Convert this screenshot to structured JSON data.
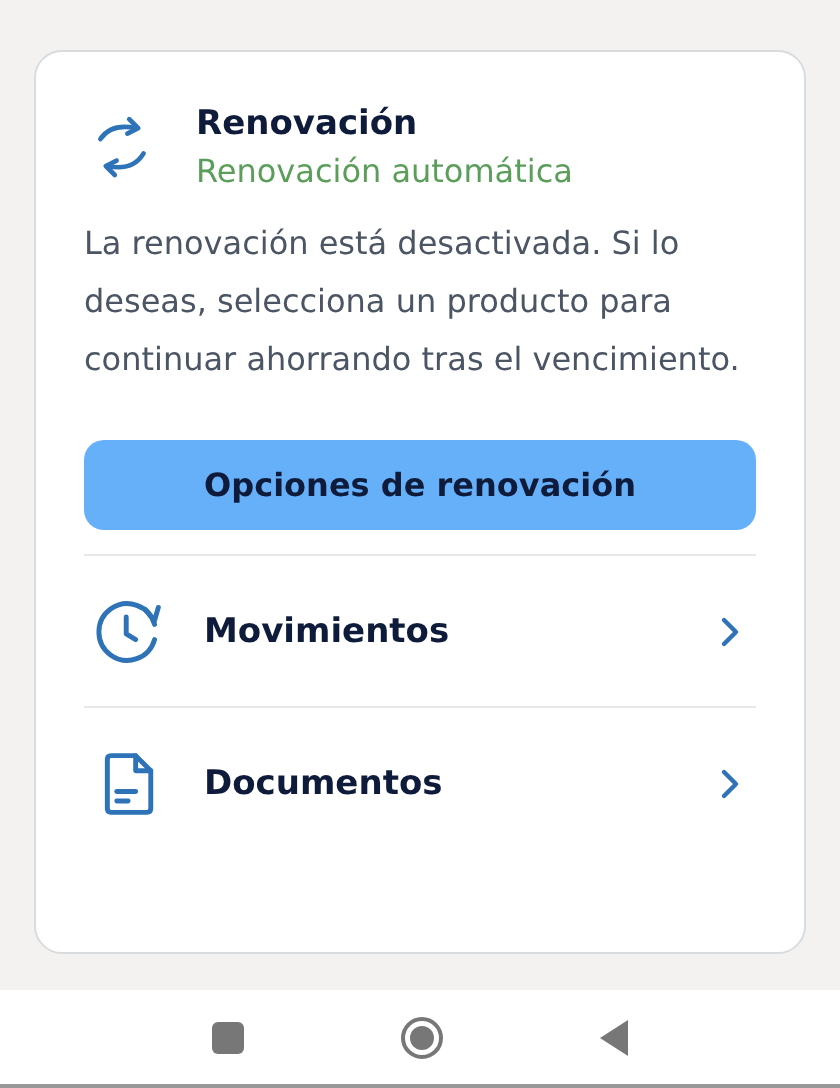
{
  "renewal": {
    "title": "Renovación",
    "subtitle": "Renovación automática",
    "description": "La renovación está desactivada. Si lo deseas, selecciona un producto para continuar ahorrando tras el vencimiento.",
    "button": "Opciones de renovación"
  },
  "links": [
    {
      "kind": "history",
      "label": "Movimientos"
    },
    {
      "kind": "document",
      "label": "Documentos"
    }
  ]
}
